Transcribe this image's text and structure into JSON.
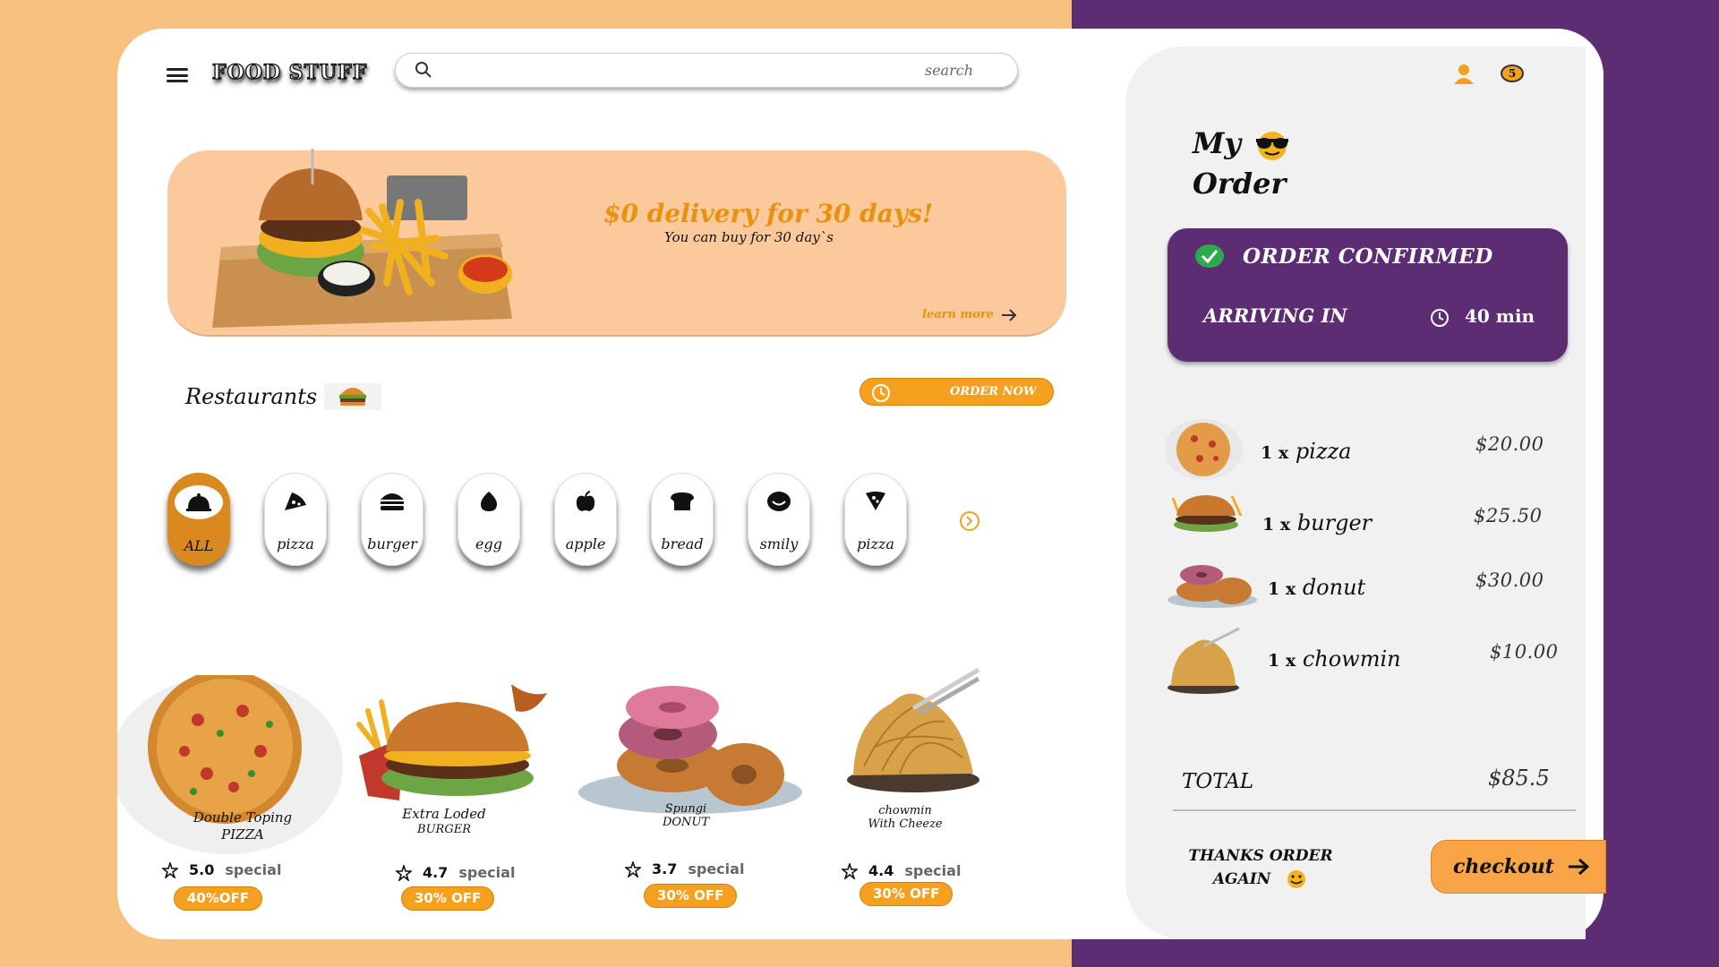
{
  "header": {
    "logo": "FOOD STUFF",
    "search_placeholder": "search"
  },
  "banner": {
    "title": "$0 delivery for 30 days!",
    "subtitle": "You can buy for 30 day`s",
    "link": "learn more"
  },
  "restaurants": {
    "title": "Restaurants",
    "order_now": "ORDER NOW"
  },
  "categories": [
    {
      "label": "ALL",
      "icon": "service-bell-icon",
      "active": true
    },
    {
      "label": "pizza",
      "icon": "pizza-slice-icon"
    },
    {
      "label": "burger",
      "icon": "burger-icon"
    },
    {
      "label": "egg",
      "icon": "egg-icon"
    },
    {
      "label": "apple",
      "icon": "apple-icon"
    },
    {
      "label": "bread",
      "icon": "bread-icon"
    },
    {
      "label": "smily",
      "icon": "smiley-icon"
    },
    {
      "label": "pizza",
      "icon": "pizza-icon"
    }
  ],
  "cards": [
    {
      "name": "Double  Toping",
      "sub": "PIZZA",
      "rating": "5.0",
      "special": "special",
      "offer": "40%OFF"
    },
    {
      "name": "Extra Loded",
      "sub": "BURGER",
      "rating": "4.7",
      "special": "special",
      "offer": "30% OFF"
    },
    {
      "name": "Spungi",
      "sub": "DONUT",
      "rating": "3.7",
      "special": "special",
      "offer": "30% OFF"
    },
    {
      "name": "chowmin",
      "sub": "With Cheeze",
      "rating": "4.4",
      "special": "special",
      "offer": "30% OFF"
    }
  ],
  "order": {
    "cart_count": "5",
    "title_line1": "My",
    "title_line2": "Order",
    "status": "ORDER CONFIRMED",
    "arriving_label": "ARRIVING IN",
    "arriving_time": "40 min",
    "items": [
      {
        "qty": "1 x",
        "name": "pizza",
        "price": "$20.00"
      },
      {
        "qty": "1 x",
        "name": "burger",
        "price": "$25.50"
      },
      {
        "qty": "1 x",
        "name": "donut",
        "price": "$30.00"
      },
      {
        "qty": "1 x",
        "name": "chowmin",
        "price": "$10.00"
      }
    ],
    "total_label": "TOTAL",
    "total_value": "$85.5",
    "thanks_line1": "THANKS ORDER",
    "thanks_line2": "AGAIN",
    "checkout": "checkout"
  },
  "colors": {
    "accent_orange": "#f5a01e",
    "banner_peach": "#fbc99b",
    "brand_purple": "#5c2d73",
    "bg_left": "#f7c27f"
  }
}
